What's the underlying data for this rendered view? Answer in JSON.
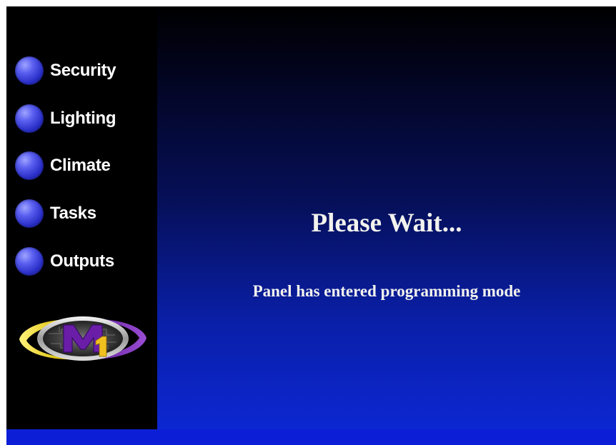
{
  "sidebar": {
    "items": [
      {
        "label": "Security",
        "icon": "orb-button-icon"
      },
      {
        "label": "Lighting",
        "icon": "orb-button-icon"
      },
      {
        "label": "Climate",
        "icon": "orb-button-icon"
      },
      {
        "label": "Tasks",
        "icon": "orb-button-icon"
      },
      {
        "label": "Outputs",
        "icon": "orb-button-icon"
      }
    ],
    "logo_text": "M1"
  },
  "main": {
    "title": "Please Wait...",
    "message": "Panel has entered programming mode"
  },
  "colors": {
    "sidebar_bg": "#000000",
    "orb_blue": "#3a3fe0",
    "text": "#f2f2ee",
    "gradient_bottom": "#0d28d8",
    "logo_yellow": "#e8d020",
    "logo_purple": "#7a2fb0"
  }
}
